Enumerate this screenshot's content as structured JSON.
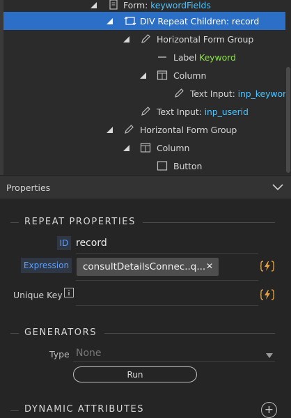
{
  "tree": {
    "rows": [
      {
        "label": "Form: ",
        "value": "keywordFields"
      },
      {
        "label": "DIV Repeat Children: record"
      },
      {
        "label": "Horizontal Form Group"
      },
      {
        "label": "Label ",
        "value": "Keyword"
      },
      {
        "label": "Column"
      },
      {
        "label": "Text Input: ",
        "value": "inp_keyword"
      },
      {
        "label": "Text Input: ",
        "value": "inp_userid"
      },
      {
        "label": "Horizontal Form Group"
      },
      {
        "label": "Column"
      },
      {
        "label": "Button"
      }
    ],
    "selected_color": "#2c6fc7"
  },
  "properties": {
    "title": "Properties",
    "repeat": {
      "section_title": "REPEAT PROPERTIES",
      "id_label": "ID",
      "id_value": "record",
      "expression_label": "Expression",
      "expression_value": "consultDetailsConnec..q...",
      "unique_key_label": "Unique Key"
    },
    "generators": {
      "section_title": "GENERATORS",
      "type_label": "Type",
      "type_value": "None",
      "run_label": "Run"
    },
    "dynamic": {
      "section_title": "DYNAMIC ATTRIBUTES"
    }
  },
  "icons": {
    "bolt": "dynamic-data-icon",
    "info": "info-icon",
    "chevron": "chevron-down-icon",
    "plus": "add-icon"
  }
}
